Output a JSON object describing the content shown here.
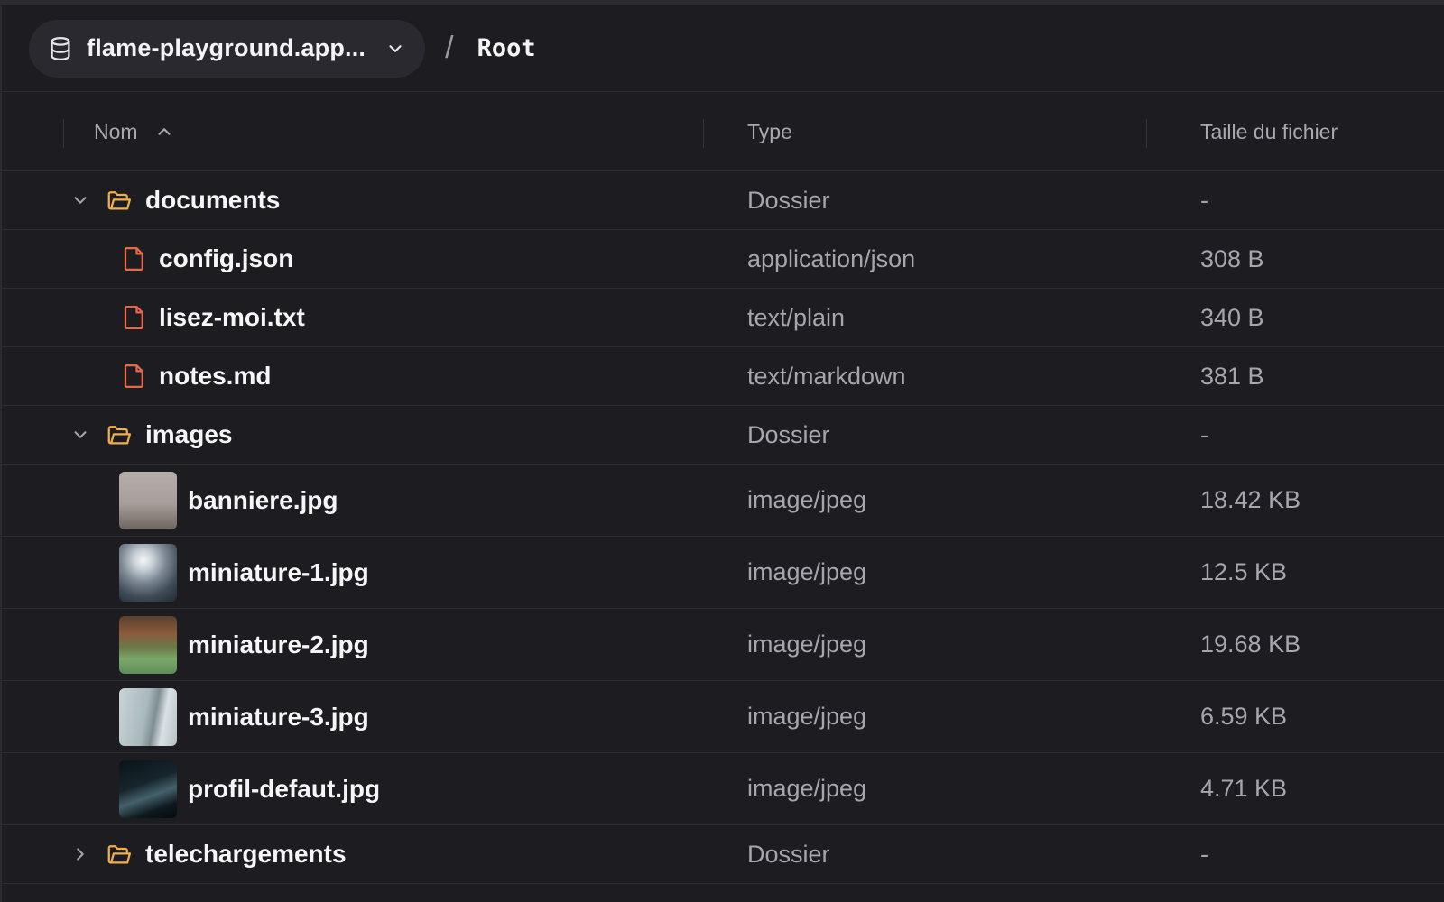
{
  "header": {
    "bucket_name": "flame-playground.app...",
    "separator": "/",
    "current_path": "Root"
  },
  "columns": {
    "name": "Nom",
    "type": "Type",
    "size": "Taille du fichier"
  },
  "rows": [
    {
      "kind": "folder",
      "expanded": true,
      "name": "documents",
      "type": "Dossier",
      "size": "-"
    },
    {
      "kind": "file",
      "name": "config.json",
      "type": "application/json",
      "size": "308 B"
    },
    {
      "kind": "file",
      "name": "lisez-moi.txt",
      "type": "text/plain",
      "size": "340 B"
    },
    {
      "kind": "file",
      "name": "notes.md",
      "type": "text/markdown",
      "size": "381 B"
    },
    {
      "kind": "folder",
      "expanded": true,
      "name": "images",
      "type": "Dossier",
      "size": "-"
    },
    {
      "kind": "image",
      "name": "banniere.jpg",
      "type": "image/jpeg",
      "size": "18.42 KB"
    },
    {
      "kind": "image",
      "name": "miniature-1.jpg",
      "type": "image/jpeg",
      "size": "12.5 KB"
    },
    {
      "kind": "image",
      "name": "miniature-2.jpg",
      "type": "image/jpeg",
      "size": "19.68 KB"
    },
    {
      "kind": "image",
      "name": "miniature-3.jpg",
      "type": "image/jpeg",
      "size": "6.59 KB"
    },
    {
      "kind": "image",
      "name": "profil-defaut.jpg",
      "type": "image/jpeg",
      "size": "4.71 KB"
    },
    {
      "kind": "folder",
      "expanded": false,
      "name": "telechargements",
      "type": "Dossier",
      "size": "-"
    }
  ],
  "icons": {
    "bucket": "database-icon",
    "dropdown": "chevron-down-icon",
    "sort": "chevron-up-icon",
    "folder": "folder-open-icon",
    "file": "file-icon",
    "expand": "chevron-right-icon",
    "collapse": "chevron-down-icon"
  },
  "colors": {
    "background": "#1c1c21",
    "pill": "#29292f",
    "folder_icon": "#f0b04a",
    "file_icon": "#e8684a",
    "text_primary": "#f6f6f8",
    "text_secondary": "#a6a6ad"
  }
}
